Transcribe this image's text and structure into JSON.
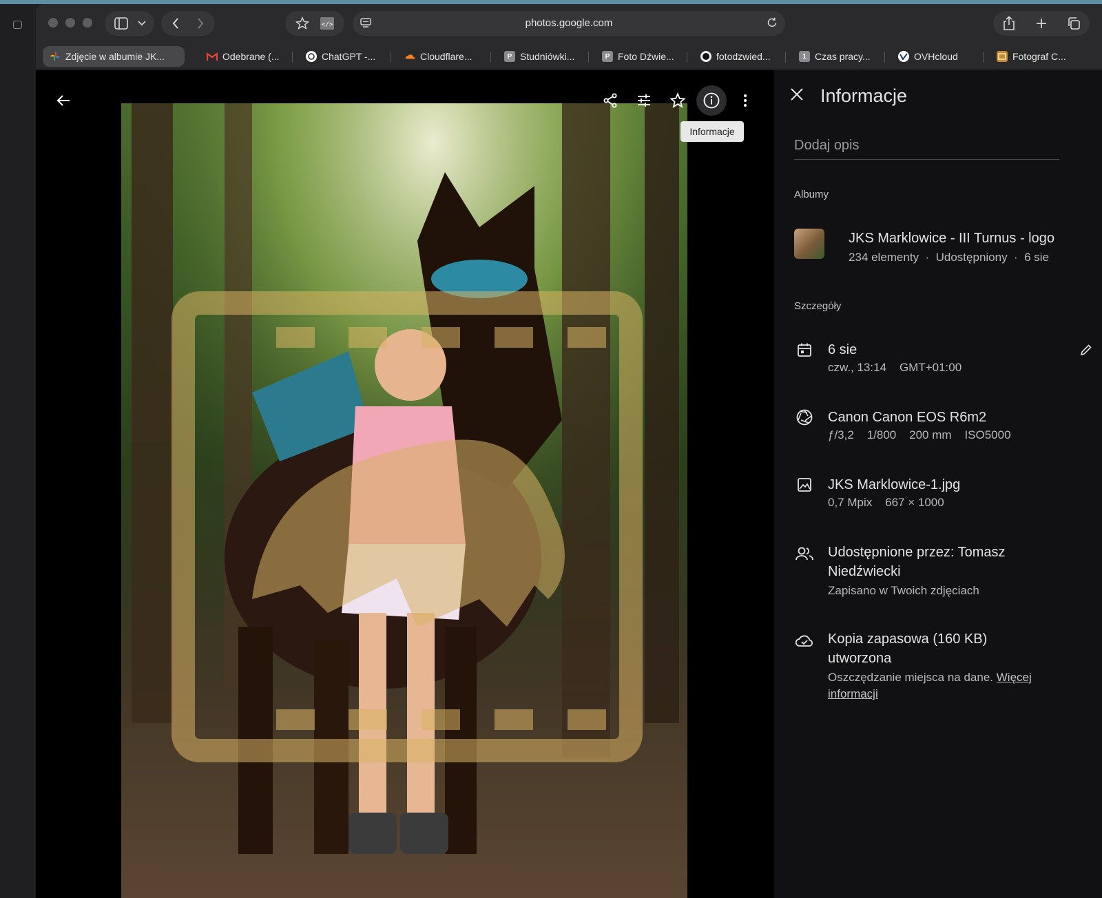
{
  "browser": {
    "url": "photos.google.com",
    "tabs": [
      {
        "label": "Zdjęcie w albumie JK...",
        "favicon": "google-photos-icon",
        "active": true
      },
      {
        "label": "Odebrane (...",
        "favicon": "gmail-icon"
      },
      {
        "label": "ChatGPT -...",
        "favicon": "chatgpt-icon"
      },
      {
        "label": "Cloudflare...",
        "favicon": "cloudflare-icon"
      },
      {
        "label": "Studniówki...",
        "favicon": "p-icon"
      },
      {
        "label": "Foto Dźwie...",
        "favicon": "p-icon"
      },
      {
        "label": "fotodzwied...",
        "favicon": "github-icon"
      },
      {
        "label": "Czas pracy...",
        "favicon": "one-icon"
      },
      {
        "label": "OVHcloud",
        "favicon": "ovh-icon"
      },
      {
        "label": "Fotograf C...",
        "favicon": "photo-icon"
      }
    ]
  },
  "viewer": {
    "tooltip": "Informacje"
  },
  "panel": {
    "title": "Informacje",
    "description_placeholder": "Dodaj opis",
    "albums_heading": "Albumy",
    "album": {
      "name": "JKS Marklowice - III Turnus - logo",
      "meta": "234 elementy  ·  Udostępniony  ·  6 sie"
    },
    "details_heading": "Szczegóły",
    "date": {
      "title": "6 sie",
      "sub": "czw., 13:14    GMT+01:00"
    },
    "camera": {
      "title": "Canon Canon EOS R6m2",
      "sub": "ƒ/3,2    1/800    200 mm    ISO5000"
    },
    "file": {
      "title": "JKS Marklowice-1.jpg",
      "sub": "0,7 Mpix    667 × 1000"
    },
    "shared": {
      "title": "Udostępnione przez: Tomasz Niedźwiecki",
      "sub": "Zapisano w Twoich zdjęciach"
    },
    "backup": {
      "title": "Kopia zapasowa (160 KB) utworzona",
      "sub": "Oszczędzanie miejsca na dane.",
      "link": "Więcej informacji"
    }
  }
}
